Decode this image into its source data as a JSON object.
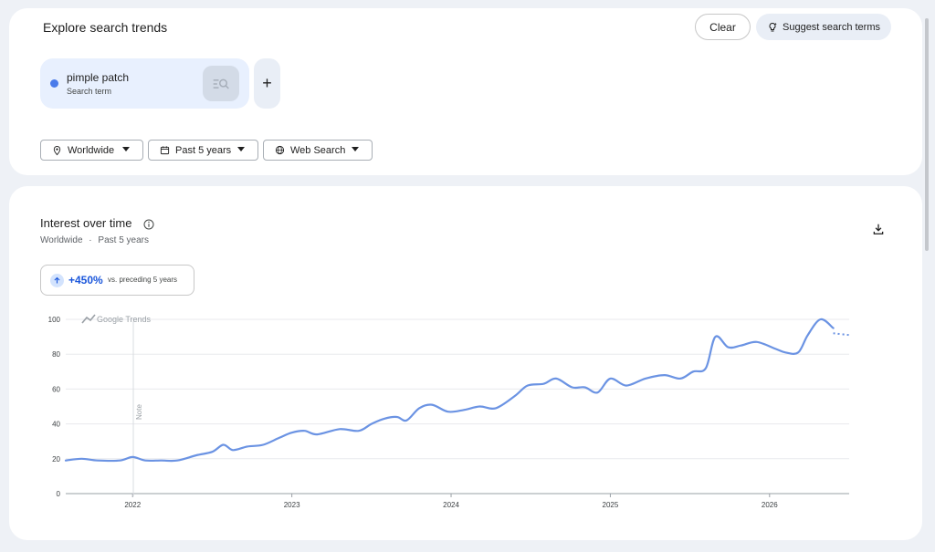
{
  "header": {
    "title": "Explore search trends",
    "clear_label": "Clear",
    "suggest_label": "Suggest search terms"
  },
  "term": {
    "name": "pimple patch",
    "subtitle": "Search term",
    "color": "#4a7bea"
  },
  "filters": {
    "location": "Worldwide",
    "time_range": "Past 5 years",
    "property": "Web Search"
  },
  "chart_panel": {
    "title": "Interest over time",
    "location": "Worldwide",
    "separator": "·",
    "time_range": "Past 5 years",
    "change_value": "+450%",
    "change_note": "vs. preceding 5 years",
    "watermark": "Google Trends",
    "note_label": "Note"
  },
  "chart_data": {
    "type": "line",
    "title": "Interest over time",
    "xlabel": "",
    "ylabel": "",
    "ylim": [
      0,
      100
    ],
    "y_ticks": [
      0,
      20,
      40,
      60,
      80,
      100
    ],
    "x_ticks": [
      "2022",
      "2023",
      "2024",
      "2025",
      "2026"
    ],
    "xlim": [
      2021.58,
      2026.5
    ],
    "grid": true,
    "line_color": "#6b93e3",
    "series": [
      {
        "name": "pimple patch",
        "x": [
          2021.58,
          2021.68,
          2021.78,
          2021.92,
          2022.0,
          2022.08,
          2022.18,
          2022.28,
          2022.4,
          2022.5,
          2022.57,
          2022.63,
          2022.72,
          2022.82,
          2022.92,
          2023.0,
          2023.08,
          2023.16,
          2023.3,
          2023.42,
          2023.5,
          2023.58,
          2023.66,
          2023.72,
          2023.8,
          2023.88,
          2023.98,
          2024.08,
          2024.18,
          2024.28,
          2024.4,
          2024.48,
          2024.58,
          2024.66,
          2024.76,
          2024.84,
          2024.92,
          2025.0,
          2025.1,
          2025.22,
          2025.34,
          2025.44,
          2025.52,
          2025.6,
          2025.66,
          2025.74,
          2025.82,
          2025.92,
          2026.04,
          2026.1,
          2026.18,
          2026.24,
          2026.32,
          2026.4
        ],
        "values": [
          19,
          20,
          19,
          19,
          21,
          19,
          19,
          19,
          22,
          24,
          28,
          25,
          27,
          28,
          32,
          35,
          36,
          34,
          37,
          36,
          40,
          43,
          44,
          42,
          49,
          51,
          47,
          48,
          50,
          49,
          56,
          62,
          63,
          66,
          61,
          61,
          58,
          66,
          62,
          66,
          68,
          66,
          70,
          72,
          90,
          84,
          85,
          87,
          83,
          81,
          81,
          91,
          100,
          95
        ],
        "partial_x": [
          2026.4,
          2026.5
        ],
        "partial_values": [
          92,
          91
        ]
      }
    ]
  }
}
